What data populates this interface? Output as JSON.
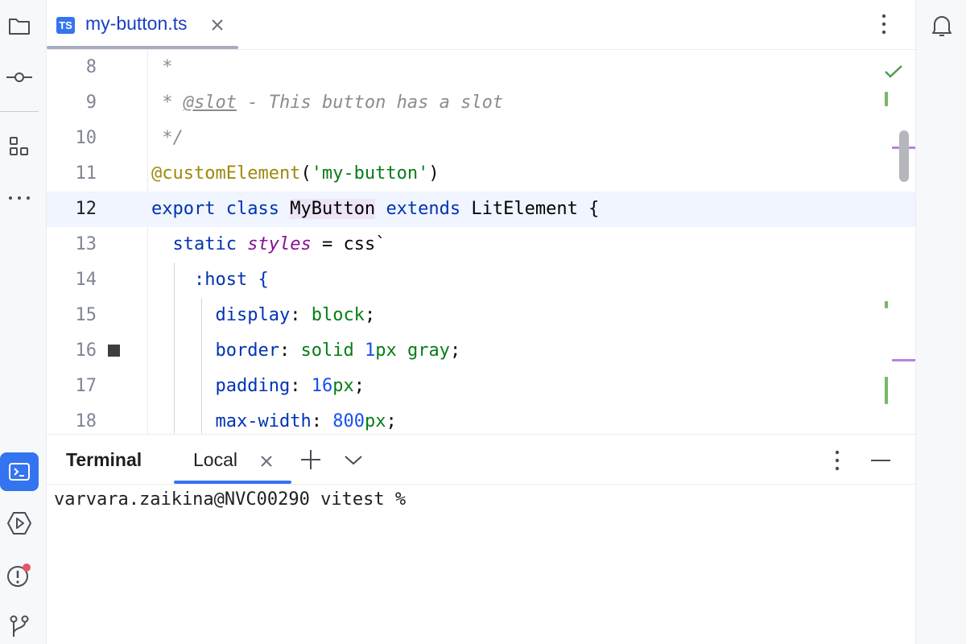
{
  "editor_tab": {
    "badge": "TS",
    "file_name": "my-button.ts"
  },
  "editor": {
    "current_line": 12,
    "lines": [
      {
        "num": "8"
      },
      {
        "num": "9"
      },
      {
        "num": "10"
      },
      {
        "num": "11"
      },
      {
        "num": "12"
      },
      {
        "num": "13"
      },
      {
        "num": "14"
      },
      {
        "num": "15"
      },
      {
        "num": "16"
      },
      {
        "num": "17"
      },
      {
        "num": "18"
      }
    ],
    "code": {
      "l8": " *",
      "l9_star": " * ",
      "l9_tag": "@slot",
      "l9_rest": " - This button has a slot",
      "l10": " */",
      "l11_deco": "@customElement",
      "l11_open": "(",
      "l11_str": "'my-button'",
      "l11_close": ")",
      "l12_export": "export",
      "l12_class": "class",
      "l12_name": "MyButton",
      "l12_extends": "extends",
      "l12_base": "LitElement",
      "l12_brace": " {",
      "l13_static": "static",
      "l13_styles": "styles",
      "l13_rest": " = css`",
      "l14": ":host {",
      "l15_prop": "display",
      "l15_colon": ": ",
      "l15_val": "block",
      "l15_end": ";",
      "l16_prop": "border",
      "l16_colon": ": ",
      "l16_val1": "solid ",
      "l16_num": "1",
      "l16_unit": "px",
      "l16_val2": " gray",
      "l16_end": ";",
      "l17_prop": "padding",
      "l17_colon": ": ",
      "l17_num": "16",
      "l17_unit": "px",
      "l17_end": ";",
      "l18_prop": "max-width",
      "l18_colon": ": ",
      "l18_num": "800",
      "l18_unit": "px",
      "l18_end": ";"
    }
  },
  "terminal": {
    "title": "Terminal",
    "tab_label": "Local",
    "prompt": "varvara.zaikina@NVC00290 vitest %"
  },
  "icons": {
    "left_strip": [
      "folder-icon",
      "commit-icon",
      "structure-icon",
      "more-icon",
      "terminal-icon",
      "run-icon",
      "problems-icon",
      "git-branch-icon"
    ],
    "right_strip": [
      "notifications-icon"
    ]
  },
  "colors": {
    "accent": "#3574f0",
    "keyword": "#0033b3",
    "string": "#067d17",
    "number": "#1750eb",
    "decorator": "#9e880d",
    "static_field": "#871094",
    "comment": "#8c8c8c",
    "current_line_bg": "#f0f5ff",
    "problem_dot": "#e55765"
  }
}
